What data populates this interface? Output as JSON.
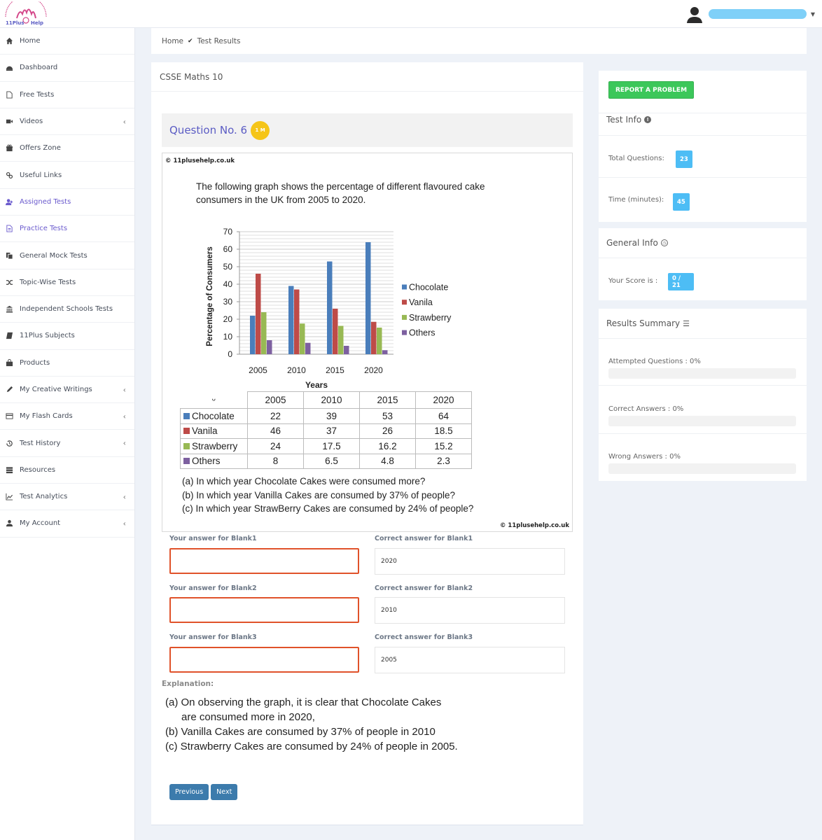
{
  "header": {
    "logo_text": "11Plus Help",
    "user_name_redacted": true
  },
  "sidebar": {
    "items": [
      {
        "label": "Home",
        "icon": "home-icon",
        "chevron": false,
        "active": false
      },
      {
        "label": "Dashboard",
        "icon": "dashboard-icon",
        "chevron": false,
        "active": false
      },
      {
        "label": "Free Tests",
        "icon": "file-icon",
        "chevron": false,
        "active": false
      },
      {
        "label": "Videos",
        "icon": "video-camera-icon",
        "chevron": true,
        "active": false
      },
      {
        "label": "Offers Zone",
        "icon": "gift-icon",
        "chevron": false,
        "active": false
      },
      {
        "label": "Useful Links",
        "icon": "link-icon",
        "chevron": false,
        "active": false
      },
      {
        "label": "Assigned Tests",
        "icon": "user-plus-icon",
        "chevron": false,
        "active": true
      },
      {
        "label": "Practice Tests",
        "icon": "document-icon",
        "chevron": false,
        "active": true
      },
      {
        "label": "General Mock Tests",
        "icon": "copy-icon",
        "chevron": false,
        "active": false
      },
      {
        "label": "Topic-Wise Tests",
        "icon": "shuffle-icon",
        "chevron": false,
        "active": false
      },
      {
        "label": "Independent Schools Tests",
        "icon": "institution-icon",
        "chevron": false,
        "active": false
      },
      {
        "label": "11Plus Subjects",
        "icon": "book-icon",
        "chevron": false,
        "active": false
      },
      {
        "label": "Products",
        "icon": "shopping-bag-icon",
        "chevron": false,
        "active": false
      },
      {
        "label": "My Creative Writings",
        "icon": "pencil-icon",
        "chevron": true,
        "active": false
      },
      {
        "label": "My Flash Cards",
        "icon": "credit-card-icon",
        "chevron": true,
        "active": false
      },
      {
        "label": "Test History",
        "icon": "history-icon",
        "chevron": true,
        "active": false
      },
      {
        "label": "Resources",
        "icon": "server-icon",
        "chevron": false,
        "active": false
      },
      {
        "label": "Test Analytics",
        "icon": "line-chart-icon",
        "chevron": true,
        "active": false
      },
      {
        "label": "My Account",
        "icon": "user-icon",
        "chevron": true,
        "active": false
      }
    ],
    "chevron_glyph": "‹"
  },
  "breadcrumb": {
    "home": "Home",
    "separator": "✔",
    "current": "Test Results"
  },
  "main": {
    "test_title": "CSSE Maths 10",
    "question_title": "Question No. 6",
    "marks_badge": "1 M",
    "question_image": {
      "copyright_top": "© 11plusehelp.co.uk",
      "copyright_bottom": "© 11plusehelp.co.uk",
      "intro": "The following graph shows the percentage of different flavoured cake consumers in the UK from 2005 to 2020.",
      "table": {
        "corner": "ᵕ",
        "columns": [
          "2005",
          "2010",
          "2015",
          "2020"
        ],
        "rows": [
          {
            "label": "Chocolate",
            "color": "#4a7ebb",
            "values": [
              "22",
              "39",
              "53",
              "64"
            ]
          },
          {
            "label": "Vanila",
            "color": "#be4b48",
            "values": [
              "46",
              "37",
              "26",
              "18.5"
            ]
          },
          {
            "label": "Strawberry",
            "color": "#98b954",
            "values": [
              "24",
              "17.5",
              "16.2",
              "15.2"
            ]
          },
          {
            "label": "Others",
            "color": "#7d60a0",
            "values": [
              "8",
              "6.5",
              "4.8",
              "2.3"
            ]
          }
        ]
      },
      "sub_questions": [
        "(a) In which year Chocolate Cakes were consumed more?",
        "(b) In which year Vanilla Cakes are consumed by 37% of people?",
        "(c) In which year StrawBerry Cakes are consumed by 24% of people?"
      ]
    },
    "answers": [
      {
        "your_label": "Your answer for Blank1",
        "your_value": "",
        "correct_label": "Correct answer for Blank1",
        "correct_value": "2020"
      },
      {
        "your_label": "Your answer for Blank2",
        "your_value": "",
        "correct_label": "Correct answer for Blank2",
        "correct_value": "2010"
      },
      {
        "your_label": "Your answer for Blank3",
        "your_value": "",
        "correct_label": "Correct answer for Blank3",
        "correct_value": "2005"
      }
    ],
    "explanation_label": "Explanation:",
    "explanation_lines": [
      "(a) On observing the graph, it is clear that Chocolate Cakes",
      "are consumed  more in 2020,",
      "(b) Vanilla Cakes are consumed by 37% of people  in 2010",
      "(c) Strawberry Cakes are consumed by 24% of people in 2005."
    ],
    "previous_label": "Previous",
    "next_label": "Next"
  },
  "chart_data": {
    "type": "bar",
    "title": "",
    "xlabel": "Years",
    "ylabel": "Percentage of Consumers",
    "categories": [
      "2005",
      "2010",
      "2015",
      "2020"
    ],
    "series": [
      {
        "name": "Chocolate",
        "color": "#4a7ebb",
        "values": [
          22,
          39,
          53,
          64
        ]
      },
      {
        "name": "Vanila",
        "color": "#be4b48",
        "values": [
          46,
          37,
          26,
          18.5
        ]
      },
      {
        "name": "Strawberry",
        "color": "#98b954",
        "values": [
          24,
          17.5,
          16.2,
          15.2
        ]
      },
      {
        "name": "Others",
        "color": "#7d60a0",
        "values": [
          8,
          6.5,
          4.8,
          2.3
        ]
      }
    ],
    "ylim": [
      0,
      70
    ],
    "yticks": [
      0,
      10,
      20,
      30,
      40,
      50,
      60,
      70
    ],
    "grid": true,
    "legend_position": "right"
  },
  "right_panel": {
    "report_button": "REPORT A PROBLEM",
    "test_info": {
      "title": "Test Info",
      "icon": "info-icon",
      "total_questions_label": "Total Questions:",
      "total_questions": "23",
      "time_label": "Time (minutes):",
      "time": "45"
    },
    "general_info": {
      "title": "General Info",
      "icon": "clock-icon",
      "score_label": "Your Score is :",
      "score": "0 / 21"
    },
    "results_summary": {
      "title": "Results Summary",
      "icon": "list-icon",
      "items": [
        {
          "label": "Attempted Questions : 0%",
          "percent": 0
        },
        {
          "label": "Correct Answers : 0%",
          "percent": 0
        },
        {
          "label": "Wrong Answers : 0%",
          "percent": 0
        }
      ]
    }
  },
  "colors": {
    "accent_purple": "#5b5cc4",
    "badge_yellow": "#f5c518",
    "report_green": "#3cc75a",
    "info_blue": "#4dbdf5",
    "nav_button": "#3c7bac",
    "wrong_border": "#e0522a"
  }
}
